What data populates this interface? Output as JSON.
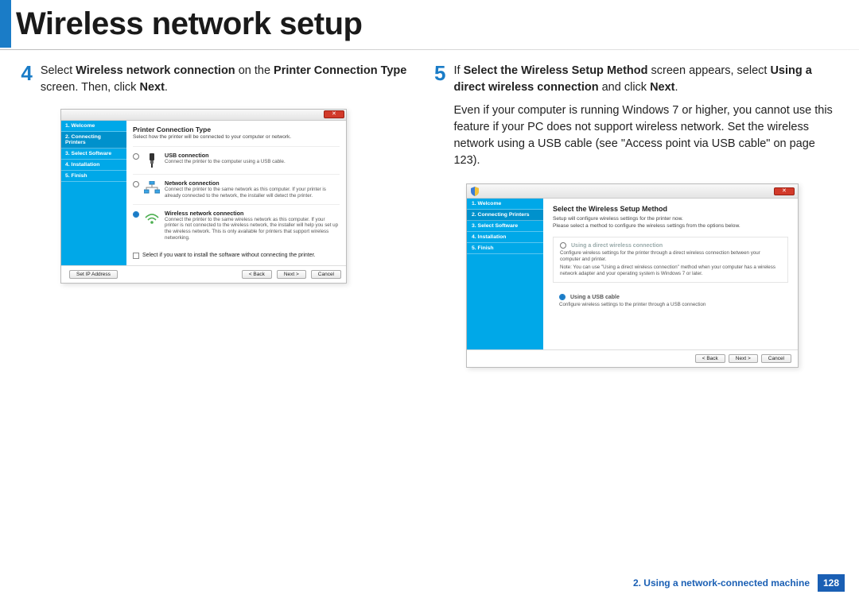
{
  "header": {
    "title": "Wireless network setup"
  },
  "steps": {
    "s4": {
      "num": "4",
      "t1": "Select ",
      "t2": "Wireless network connection",
      "t3": " on the ",
      "t4": "Printer Connection Type",
      "t5": " screen. Then, click ",
      "t6": "Next",
      "t7": "."
    },
    "s5": {
      "num": "5",
      "t1": "If ",
      "t2": "Select the Wireless Setup Method",
      "t3": " screen appears, select ",
      "t4": "Using a direct wireless connection",
      "t5": " and click ",
      "t6": "Next",
      "t7": ".",
      "para": "Even if your computer is running Windows 7 or higher, you cannot use this feature if your PC does not support wireless network. Set the wireless network using a USB cable (see \"Access point via USB cable\" on page 123)."
    }
  },
  "screenshotA": {
    "side": [
      "1. Welcome",
      "2. Connecting Printers",
      "3. Select Software",
      "4. Installation",
      "5. Finish"
    ],
    "title": "Printer Connection Type",
    "subtitle": "Select how the printer will be connected to your computer or network.",
    "opt_usb": {
      "title": "USB connection",
      "desc": "Connect the printer to the computer using a USB cable."
    },
    "opt_net": {
      "title": "Network connection",
      "desc": "Connect the printer to the same network as this computer. If your printer is already connected to the network, the installer will detect the printer."
    },
    "opt_wifi": {
      "title": "Wireless network connection",
      "desc": "Connect the printer to the same wireless network as this computer. If your printer is not connected to the wireless network, the installer will help you set up the wireless network. This is only available for printers that support wireless networking."
    },
    "checkbox": "Select if you want to install the software without connecting the printer.",
    "btn_ip": "Set IP Address",
    "btn_back": "< Back",
    "btn_next": "Next >",
    "btn_cancel": "Cancel"
  },
  "screenshotB": {
    "side": [
      "1. Welcome",
      "2. Connecting Printers",
      "3. Select Software",
      "4. Installation",
      "5. Finish"
    ],
    "title": "Select the Wireless Setup Method",
    "l1": "Setup will configure wireless settings for the printer now.",
    "l2": "Please select a method to configure the wireless settings from the options below.",
    "opt_direct": {
      "title": "Using a direct wireless connection",
      "desc": "Configure wireless settings for the printer through a direct wireless connection between your computer and printer.",
      "note": "Note: You can use \"Using a direct wireless connection\" method when your computer has a wireless network adapter and your operating system is Windows 7 or later."
    },
    "opt_usb": {
      "title": "Using a USB cable",
      "desc": "Configure wireless settings to the printer through a USB connection"
    },
    "btn_back": "< Back",
    "btn_next": "Next >",
    "btn_cancel": "Cancel"
  },
  "footer": {
    "text": "2.  Using a network-connected machine",
    "page": "128"
  }
}
